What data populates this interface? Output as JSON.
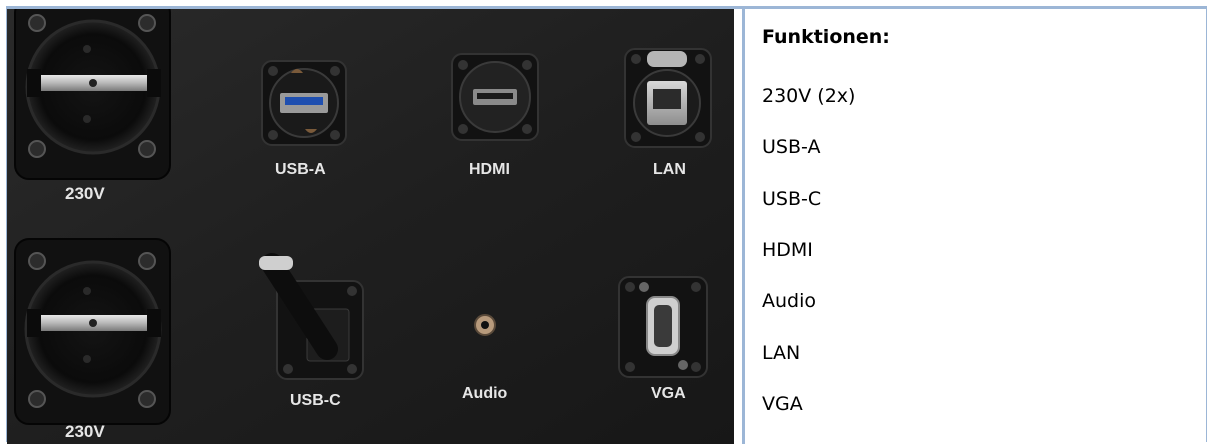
{
  "photo": {
    "labels": {
      "socket_top": "230V",
      "socket_bottom": "230V",
      "usb_a": "USB-A",
      "hdmi": "HDMI",
      "lan": "LAN",
      "usb_c": "USB-C",
      "audio": "Audio",
      "vga": "VGA"
    }
  },
  "functions": {
    "heading": "Funktionen:",
    "items": [
      "230V (2x)",
      "USB-A",
      "USB-C",
      "HDMI",
      "Audio",
      "LAN",
      "VGA"
    ]
  }
}
